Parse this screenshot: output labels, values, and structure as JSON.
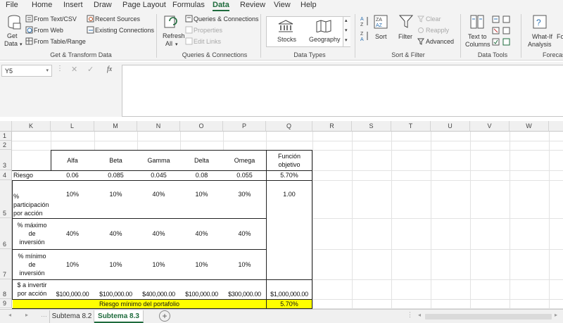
{
  "ribbon_tabs": [
    "File",
    "Home",
    "Insert",
    "Draw",
    "Page Layout",
    "Formulas",
    "Data",
    "Review",
    "View",
    "Help"
  ],
  "active_tab": "Data",
  "ribbon": {
    "get_data": "Get",
    "get_data2": "Data",
    "from_text": "From Text/CSV",
    "from_web": "From Web",
    "from_table": "From Table/Range",
    "recent_sources": "Recent Sources",
    "existing_connections": "Existing Connections",
    "group_get": "Get & Transform Data",
    "refresh": "Refresh",
    "refresh2": "All",
    "queries": "Queries & Connections",
    "properties": "Properties",
    "edit_links": "Edit Links",
    "group_queries": "Queries & Connections",
    "stocks": "Stocks",
    "geography": "Geography",
    "group_types": "Data Types",
    "sort": "Sort",
    "filter": "Filter",
    "clear": "Clear",
    "reapply": "Reapply",
    "advanced": "Advanced",
    "group_sort": "Sort & Filter",
    "text_to": "Text to",
    "columns": "Columns",
    "group_tools": "Data Tools",
    "whatif": "What-If",
    "analysis": "Analysis",
    "fo": "Fo",
    "forecast": "Forecas"
  },
  "formula_bar": {
    "name_box": "Y5",
    "fx": "fx",
    "formula": ""
  },
  "columns": [
    "K",
    "L",
    "M",
    "N",
    "O",
    "P",
    "Q",
    "R",
    "S",
    "T",
    "U",
    "V",
    "W"
  ],
  "rows": [
    "1",
    "2",
    "3",
    "4",
    "5",
    "6",
    "7",
    "8",
    "9"
  ],
  "table": {
    "headers": [
      "Alfa",
      "Beta",
      "Gamma",
      "Delta",
      "Omega"
    ],
    "objective_header": "Función objetivo",
    "riesgo_label": "Riesgo",
    "riesgo": [
      "0.06",
      "0.085",
      "0.045",
      "0.08",
      "0.055"
    ],
    "riesgo_obj": "5.70%",
    "part_label": "% participación por acción",
    "part": [
      "10%",
      "10%",
      "40%",
      "10%",
      "30%"
    ],
    "part_obj": "1.00",
    "max_label": "% máximo de inversión",
    "max": [
      "40%",
      "40%",
      "40%",
      "40%",
      "40%"
    ],
    "min_label": "% mínimo de inversión",
    "min": [
      "10%",
      "10%",
      "10%",
      "10%",
      "10%"
    ],
    "inv_label": "$ a invertir por acción",
    "inv": [
      "$100,000.00",
      "$100,000.00",
      "$400,000.00",
      "$100,000.00",
      "$300,000.00"
    ],
    "inv_total": "$1,000,000.00",
    "summary_label": "Riesgo mínimo del portafolio",
    "summary_value": "5.70%",
    "highlight_color": "#ffff00"
  },
  "sheets": [
    "Subtema 8.2",
    "Subtema 8.3"
  ],
  "active_sheet": "Subtema 8.3",
  "add_sheet": "+"
}
